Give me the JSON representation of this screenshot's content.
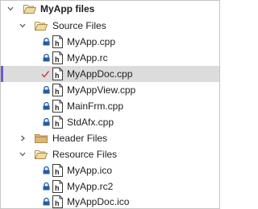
{
  "tree": {
    "root": {
      "label": "MyApp files",
      "icon": "open-folder-icon",
      "expanded": true
    },
    "folders": [
      {
        "label": "Source Files",
        "expanded": true,
        "icon": "open-folder-icon",
        "files": [
          {
            "label": "MyApp.cpp",
            "status": "checked-in"
          },
          {
            "label": "MyApp.rc",
            "status": "checked-in"
          },
          {
            "label": "MyAppDoc.cpp",
            "status": "checked-out",
            "selected": true
          },
          {
            "label": "MyAppView.cpp",
            "status": "checked-in"
          },
          {
            "label": "MainFrm.cpp",
            "status": "checked-in"
          },
          {
            "label": "StdAfx.cpp",
            "status": "checked-in"
          }
        ]
      },
      {
        "label": "Header Files",
        "expanded": false,
        "icon": "closed-folder-icon"
      },
      {
        "label": "Resource Files",
        "expanded": true,
        "icon": "open-folder-icon",
        "files": [
          {
            "label": "MyApp.ico",
            "status": "checked-in"
          },
          {
            "label": "MyApp.rc2",
            "status": "checked-in"
          },
          {
            "label": "MyAppDoc.ico",
            "status": "checked-in"
          }
        ]
      }
    ]
  },
  "colors": {
    "folder": "#dcb67a",
    "lock": "#1f5fa8",
    "checkmark": "#c0392b",
    "selection": "#dcdcdc",
    "selection_marker": "#6a5acd"
  }
}
